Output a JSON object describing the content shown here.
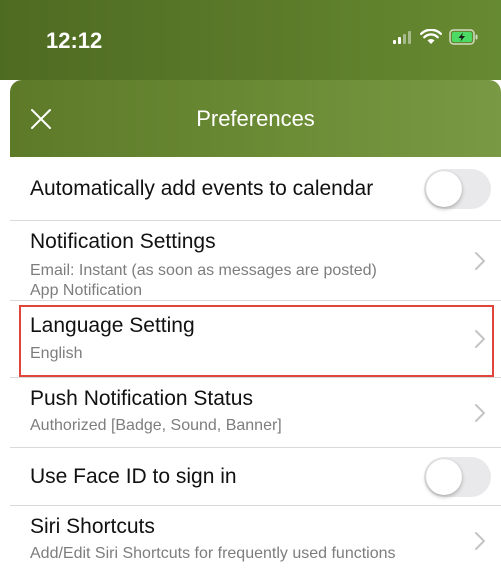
{
  "status_bar": {
    "time": "12:12",
    "icons": [
      "cellular-signal-icon",
      "wifi-icon",
      "battery-charging-icon"
    ]
  },
  "nav": {
    "title": "Preferences",
    "close_icon": "close-icon"
  },
  "rows": [
    {
      "title": "Automatically add events to calendar",
      "control": "toggle",
      "toggle_on": false
    },
    {
      "title": "Notification Settings",
      "subtitle_lines": [
        "Email: Instant (as soon as messages are posted)",
        "App Notification"
      ],
      "control": "chevron"
    },
    {
      "title": "Language Setting",
      "subtitle": "English",
      "control": "chevron",
      "highlighted": true
    },
    {
      "title": "Push Notification Status",
      "subtitle": "Authorized [Badge, Sound, Banner]",
      "control": "chevron"
    },
    {
      "title": "Use Face ID to sign in",
      "control": "toggle",
      "toggle_on": false
    },
    {
      "title": "Siri Shortcuts",
      "subtitle": "Add/Edit Siri Shortcuts for frequently used functions",
      "control": "chevron"
    }
  ],
  "colors": {
    "header_green": "#668a31",
    "nav_green": "#6b8b35",
    "highlight_red": "#e0443a",
    "toggle_off": "#e9e9eb"
  }
}
